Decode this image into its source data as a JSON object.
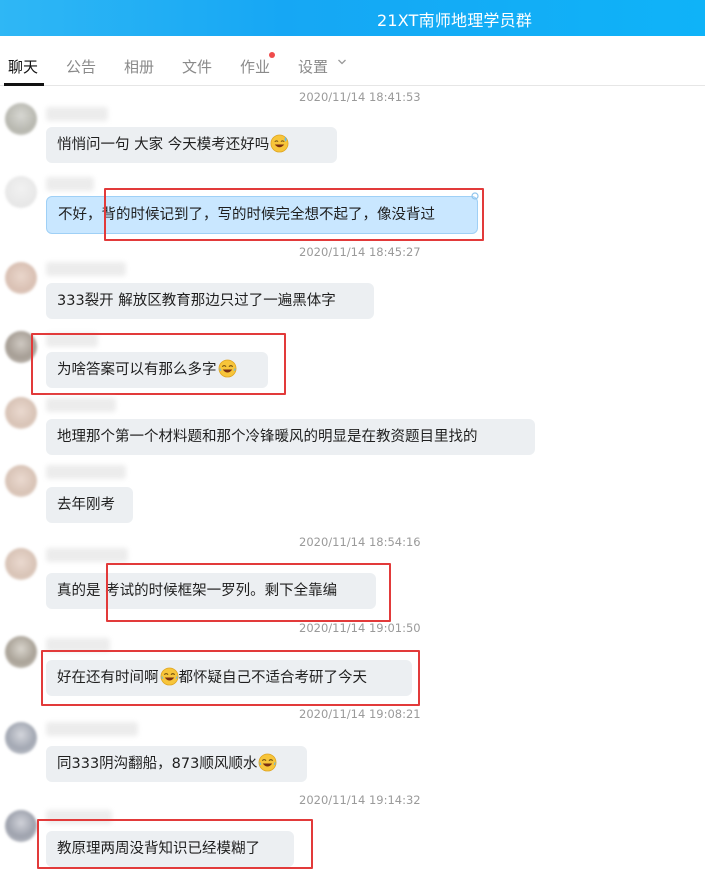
{
  "window": {
    "title": "21XT南师地理学员群"
  },
  "tabs": [
    {
      "label": "聊天"
    },
    {
      "label": "公告"
    },
    {
      "label": "相册"
    },
    {
      "label": "文件"
    },
    {
      "label": "作业"
    },
    {
      "label": "设置"
    }
  ],
  "colors": {
    "accent": "#16a7f4",
    "highlight": "#e23a3a",
    "bubble": "#eceff2",
    "bubble_self": "#c9e7ff"
  },
  "messages": [
    {
      "timestamp": "2020/11/14 18:41:53",
      "text": "悄悄问一句  大家 今天模考还好吗",
      "emoji": "laugh-sweat-emoji"
    },
    {
      "text": "不好，背的时候记到了，写的时候完全想不起了，像没背过"
    },
    {
      "timestamp": "2020/11/14 18:45:27",
      "text": "333裂开 解放区教育那边只过了一遍黑体字"
    },
    {
      "text": "为啥答案可以有那么多字",
      "emoji": "tears-of-joy-emoji"
    },
    {
      "text": "地理那个第一个材料题和那个冷锋暖风的明显是在教资题目里找的"
    },
    {
      "text": "去年刚考"
    },
    {
      "timestamp": "2020/11/14 18:54:16",
      "text": "真的是 考试的时候框架一罗列。剩下全靠编"
    },
    {
      "timestamp": "2020/11/14 19:01:50",
      "text_a": "好在还有时间啊",
      "text_b": "都怀疑自己不适合考研了今天",
      "emoji": "tears-of-joy-emoji"
    },
    {
      "timestamp": "2020/11/14 19:08:21",
      "text": "同333阴沟翻船，873顺风顺水",
      "emoji": "tears-of-joy-emoji"
    },
    {
      "timestamp": "2020/11/14 19:14:32",
      "text": "教原理两周没背知识已经模糊了"
    }
  ]
}
